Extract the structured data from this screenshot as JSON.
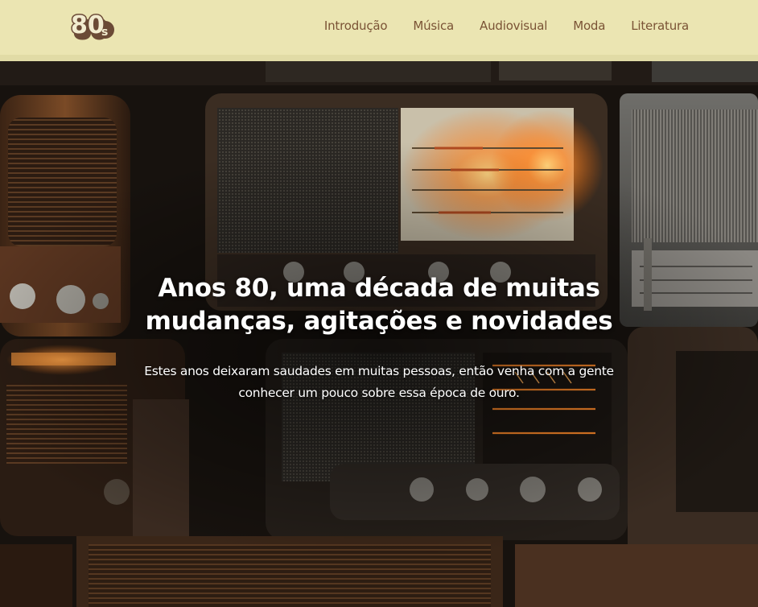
{
  "header": {
    "logo": {
      "text": "80",
      "suffix": "s",
      "icon": "eighties-logo"
    },
    "nav": [
      {
        "label": "Introdução"
      },
      {
        "label": "Música"
      },
      {
        "label": "Audiovisual"
      },
      {
        "label": "Moda"
      },
      {
        "label": "Literatura"
      }
    ]
  },
  "hero": {
    "title": "Anos 80, uma década de muitas mudanças, agitações e novidades",
    "subtitle": "Estes anos deixaram saudades em muitas pessoas, então venha com a gente conhecer um pouco sobre essa época de ouro.",
    "background": "vintage-radios-photo"
  },
  "colors": {
    "header_bg": "#ebe5b2",
    "nav_text": "#7a5335",
    "logo_brown": "#6b4a36",
    "hero_text": "#ffffff",
    "glow": "#ff9a3c"
  }
}
